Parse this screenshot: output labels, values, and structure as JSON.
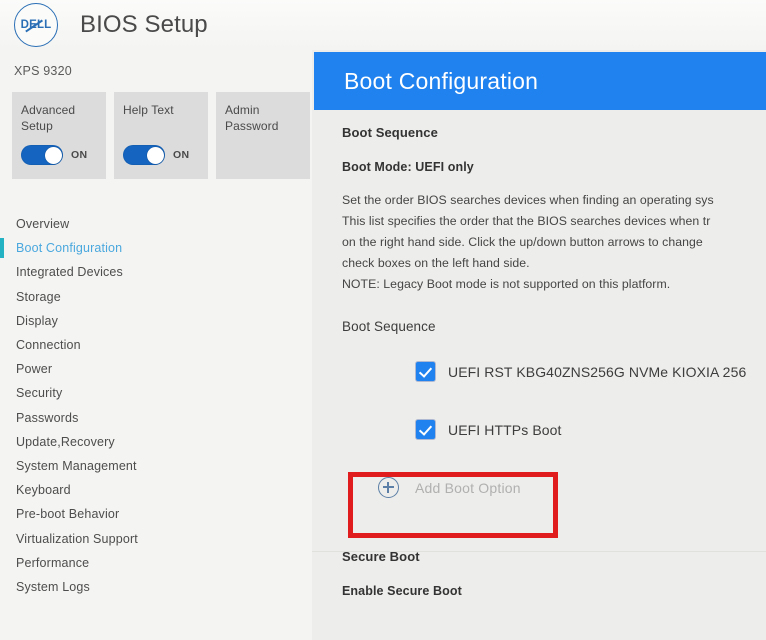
{
  "brand": {
    "logo_text": "DELL",
    "logo_icon": "dell-circle-logo"
  },
  "header": {
    "title": "BIOS Setup"
  },
  "sidebar": {
    "model": "XPS 9320",
    "cards": [
      {
        "title": "Advanced Setup",
        "has_toggle": true,
        "toggle_state": "ON"
      },
      {
        "title": "Help Text",
        "has_toggle": true,
        "toggle_state": "ON"
      },
      {
        "title": "Admin Password",
        "has_toggle": false,
        "toggle_state": ""
      }
    ],
    "items": [
      {
        "label": "Overview",
        "active": false
      },
      {
        "label": "Boot Configuration",
        "active": true
      },
      {
        "label": "Integrated Devices",
        "active": false
      },
      {
        "label": "Storage",
        "active": false
      },
      {
        "label": "Display",
        "active": false
      },
      {
        "label": "Connection",
        "active": false
      },
      {
        "label": "Power",
        "active": false
      },
      {
        "label": "Security",
        "active": false
      },
      {
        "label": "Passwords",
        "active": false
      },
      {
        "label": "Update,Recovery",
        "active": false
      },
      {
        "label": "System Management",
        "active": false
      },
      {
        "label": "Keyboard",
        "active": false
      },
      {
        "label": "Pre-boot Behavior",
        "active": false
      },
      {
        "label": "Virtualization Support",
        "active": false
      },
      {
        "label": "Performance",
        "active": false
      },
      {
        "label": "System Logs",
        "active": false
      }
    ]
  },
  "main": {
    "banner_title": "Boot Configuration",
    "section_boot_sequence_heading": "Boot Sequence",
    "boot_mode": "Boot Mode: UEFI only",
    "description_lines": [
      "Set the order BIOS searches devices when finding an operating sys",
      "This list specifies the order that the BIOS searches devices when tr",
      "on the right hand side.  Click the up/down button arrows to change",
      "check boxes on the left hand side.",
      "NOTE: Legacy Boot mode is not supported on this platform."
    ],
    "boot_sequence_label": "Boot Sequence",
    "boot_entries": [
      {
        "label": "UEFI RST KBG40ZNS256G NVMe KIOXIA 256",
        "checked": true
      },
      {
        "label": "UEFI HTTPs Boot",
        "checked": true
      }
    ],
    "add_boot_option": {
      "label": "Add Boot Option",
      "icon": "plus-circle-icon",
      "disabled": true
    },
    "secure_boot_heading": "Secure Boot",
    "enable_secure_boot_label": "Enable Secure Boot"
  },
  "annotation": {
    "color": "#e01c1c",
    "target": "add-boot-option"
  },
  "colors": {
    "banner_blue": "#1f82ef",
    "toggle_blue": "#1565c0",
    "checkbox_blue": "#1f82ef",
    "active_nav_text": "#4aa8de",
    "active_nav_bar": "#23b2c4",
    "annotation_red": "#e01c1c"
  }
}
